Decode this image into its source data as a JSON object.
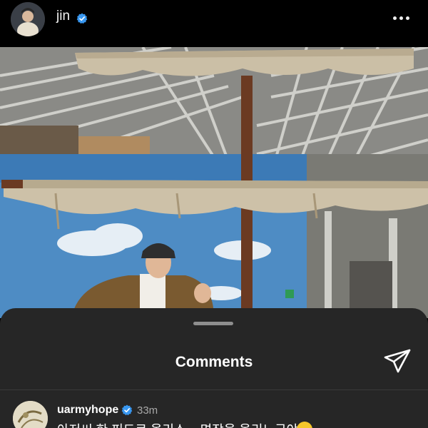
{
  "header": {
    "username": "jin",
    "verified_icon": "verified-badge-icon",
    "more_icon": "more-horizontal-icon"
  },
  "post": {
    "image": "photo"
  },
  "comments_sheet": {
    "title": "Comments",
    "send_icon": "paper-plane-icon",
    "comments": [
      {
        "username": "uarmyhope",
        "verified": true,
        "time": "33m",
        "text": "아저씨 한 피드로 올리소 .. 면장을 올리느구야 .."
      }
    ]
  },
  "colors": {
    "background": "#000000",
    "sheet": "#262626",
    "verified_blue": "#3897f0",
    "muted_text": "#a8a8a8"
  }
}
